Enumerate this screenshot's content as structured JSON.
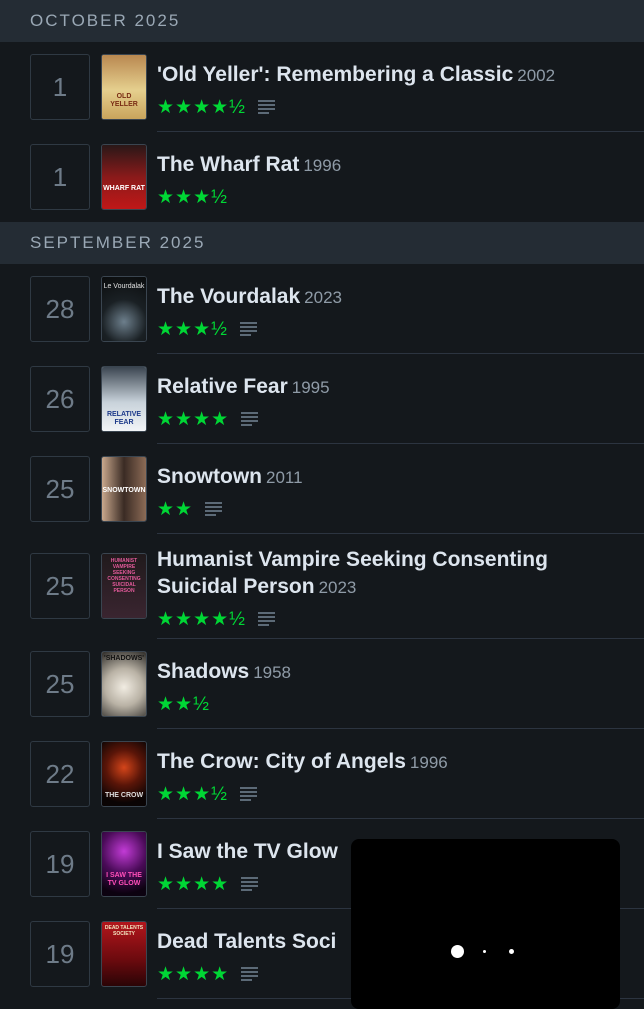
{
  "sections": [
    {
      "label": "OCTOBER 2025"
    },
    {
      "label": "SEPTEMBER 2025"
    }
  ],
  "entries": [
    {
      "day": "1",
      "title": "'Old Yeller': Remembering a Classic",
      "year": "2002",
      "stars": "★★★★½",
      "has_review": true,
      "poster_text": "OLD YELLER"
    },
    {
      "day": "1",
      "title": "The Wharf Rat",
      "year": "1996",
      "stars": "★★★½",
      "has_review": false,
      "poster_text": "WHARF RAT"
    },
    {
      "day": "28",
      "title": "The Vourdalak",
      "year": "2023",
      "stars": "★★★½",
      "has_review": true,
      "poster_text": "Le Vourdalak"
    },
    {
      "day": "26",
      "title": "Relative Fear",
      "year": "1995",
      "stars": "★★★★",
      "has_review": true,
      "poster_text": "RELATIVE FEAR"
    },
    {
      "day": "25",
      "title": "Snowtown",
      "year": "2011",
      "stars": "★★",
      "has_review": true,
      "poster_text": "SNOWTOWN"
    },
    {
      "day": "25",
      "title": "Humanist Vampire Seeking Consenting",
      "title2": "Suicidal Person",
      "year": "2023",
      "stars": "★★★★½",
      "has_review": true,
      "poster_text": "HUMANIST VAMPIRE SEEKING CONSENTING SUICIDAL PERSON"
    },
    {
      "day": "25",
      "title": "Shadows",
      "year": "1958",
      "stars": "★★½",
      "has_review": false,
      "poster_text": "'SHADOWS'"
    },
    {
      "day": "22",
      "title": "The Crow: City of Angels",
      "year": "1996",
      "stars": "★★★½",
      "has_review": true,
      "poster_text": "THE CROW"
    },
    {
      "day": "19",
      "title": "I Saw the TV Glow",
      "year": "",
      "stars": "★★★★",
      "has_review": true,
      "poster_text": "I SAW THE TV GLOW"
    },
    {
      "day": "19",
      "title": "Dead Talents Soci",
      "year": "",
      "stars": "★★★★",
      "has_review": true,
      "poster_text": "DEAD TALENTS SOCIETY"
    }
  ],
  "colors": {
    "star": "#00d735",
    "background": "#14181c",
    "header": "#242c34"
  },
  "icons": {
    "review": "review-lines-icon"
  }
}
